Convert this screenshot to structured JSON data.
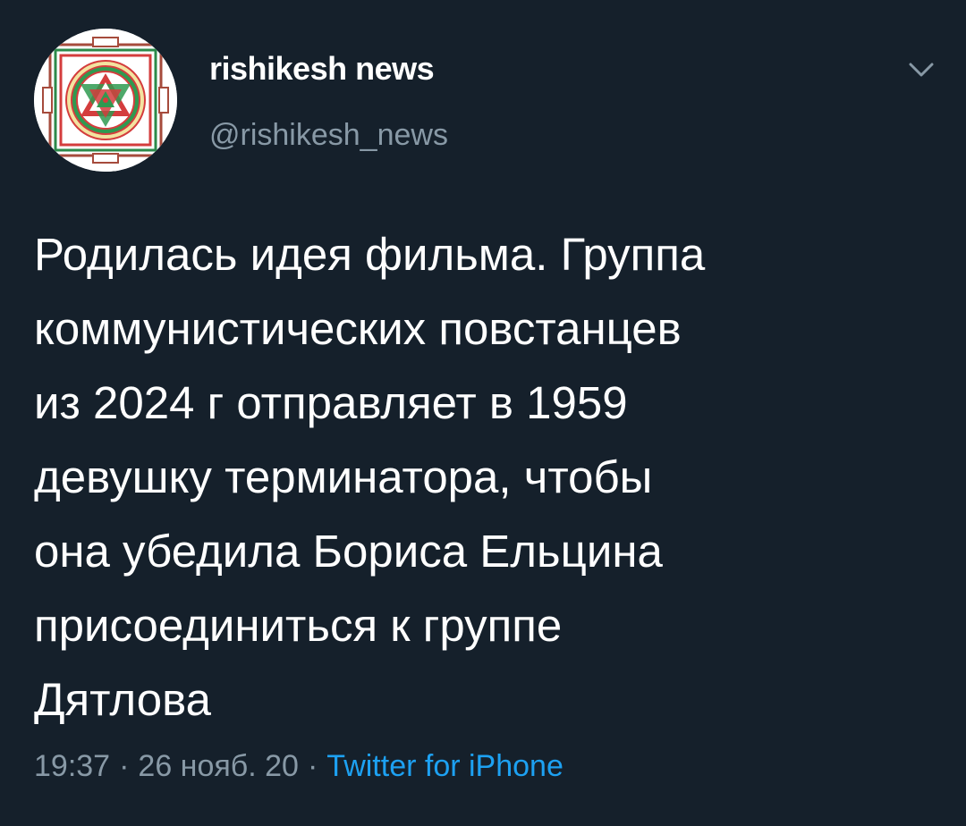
{
  "user": {
    "display_name": "rishikesh news",
    "handle": "@rishikesh_news",
    "avatar_icon": "sri-yantra-icon"
  },
  "tweet": {
    "text": "Родилась идея фильма. Группа\nкоммунистических повстанцев\nиз 2024 г отправляет в 1959\nдевушку терминатора, чтобы\nона убедила Бориса Ельцина\nприсоединиться к группе\nДятлова",
    "time": "19:37",
    "date": "26 нояб. 20",
    "source": "Twitter for iPhone",
    "separator": "·"
  },
  "menu": {
    "icon": "chevron-down-icon"
  },
  "colors": {
    "background": "#15202b",
    "primary_text": "#ffffff",
    "secondary_text": "#8899a6",
    "accent": "#1da1f2"
  }
}
